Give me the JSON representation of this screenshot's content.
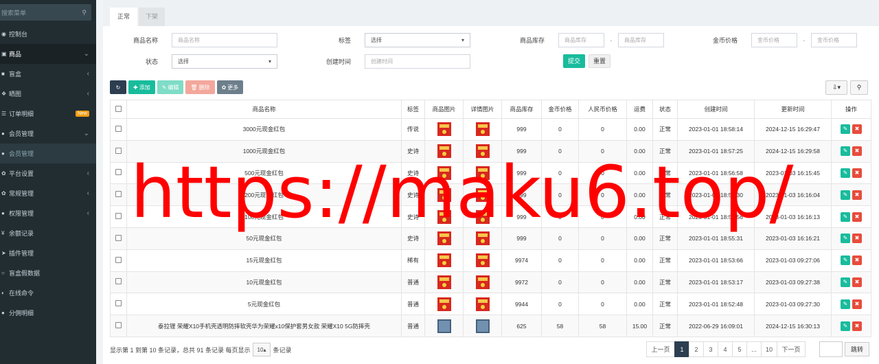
{
  "sidebar": {
    "search_placeholder": "搜索菜单",
    "items": [
      {
        "icon": "dashboard-icon",
        "glyph": "◉",
        "label": "控制台",
        "arrow": ""
      },
      {
        "icon": "shopping-bag-icon",
        "glyph": "▣",
        "label": "商品",
        "arrow": "⌄",
        "state": "active"
      },
      {
        "icon": "cube-icon",
        "glyph": "■",
        "label": "盲盒",
        "arrow": "‹"
      },
      {
        "icon": "gift-icon",
        "glyph": "❖",
        "label": "晒图",
        "arrow": "‹"
      },
      {
        "icon": "list-icon",
        "glyph": "☰",
        "label": "订单明细",
        "badge": "New"
      },
      {
        "icon": "users-icon",
        "glyph": "●",
        "label": "会员管理",
        "arrow": "⌄"
      },
      {
        "icon": "user-icon",
        "glyph": "●",
        "label": "会员管理",
        "arrow": "",
        "state": "sub"
      },
      {
        "icon": "gear-icon",
        "glyph": "✿",
        "label": "平台设置",
        "arrow": "‹"
      },
      {
        "icon": "gears-icon",
        "glyph": "✿",
        "label": "常规管理",
        "arrow": "‹"
      },
      {
        "icon": "users-icon",
        "glyph": "●",
        "label": "权限管理",
        "arrow": "‹"
      },
      {
        "icon": "yen-icon",
        "glyph": "¥",
        "label": "余额记录",
        "arrow": ""
      },
      {
        "icon": "rocket-icon",
        "glyph": "➤",
        "label": "插件管理",
        "arrow": ""
      },
      {
        "icon": "circle-icon",
        "glyph": "○",
        "label": "盲盒假数据",
        "arrow": ""
      },
      {
        "icon": "toggle-icon",
        "glyph": "◐",
        "label": "在线命令",
        "arrow": ""
      },
      {
        "icon": "users-icon",
        "glyph": "●",
        "label": "分佣明细",
        "arrow": ""
      }
    ]
  },
  "tabs": {
    "normal": "正常",
    "off": "下架"
  },
  "filters": {
    "name_label": "商品名称",
    "name_placeholder": "商品名称",
    "tag_label": "标签",
    "tag_value": "选择",
    "stock_label": "商品库存",
    "stock_min_placeholder": "商品库存",
    "stock_max_placeholder": "商品库存",
    "coin_label": "金币价格",
    "coin_min_placeholder": "金币价格",
    "coin_max_placeholder": "金币价格",
    "status_label": "状态",
    "status_value": "选择",
    "created_label": "创建时间",
    "created_placeholder": "创建时间",
    "dash": "-",
    "submit": "提交",
    "reset": "重置"
  },
  "toolbar": {
    "add": "添加",
    "edit": "编辑",
    "delete": "删除",
    "more": "更多"
  },
  "table": {
    "headers": [
      "商品名称",
      "标签",
      "商品图片",
      "详情图片",
      "商品库存",
      "金币价格",
      "人民币价格",
      "运费",
      "状态",
      "创建时间",
      "更新时间",
      "操作"
    ],
    "rows": [
      {
        "name": "3000元现金红包",
        "tag": "传说",
        "tag_type": "legend",
        "img": "red",
        "stock": "999",
        "coin": "0",
        "rmb": "0",
        "ship": "0.00",
        "status": "正常",
        "created": "2023-01-01 18:58:14",
        "updated": "2024-12-15 16:29:47"
      },
      {
        "name": "1000元现金红包",
        "tag": "史诗",
        "tag_type": "epic",
        "img": "red",
        "stock": "999",
        "coin": "0",
        "rmb": "0",
        "ship": "0.00",
        "status": "正常",
        "created": "2023-01-01 18:57:25",
        "updated": "2024-12-15 16:29:58"
      },
      {
        "name": "500元现金红包",
        "tag": "史诗",
        "tag_type": "epic",
        "img": "red",
        "stock": "999",
        "coin": "0",
        "rmb": "0",
        "ship": "0.00",
        "status": "正常",
        "created": "2023-01-01 18:56:58",
        "updated": "2023-01-03 16:15:45"
      },
      {
        "name": "200元现金红包",
        "tag": "史诗",
        "tag_type": "epic",
        "img": "red",
        "stock": "999",
        "coin": "0",
        "rmb": "0",
        "ship": "0.00",
        "status": "正常",
        "created": "2023-01-01 18:56:30",
        "updated": "2023-01-03 16:16:04"
      },
      {
        "name": "100元现金红包",
        "tag": "史诗",
        "tag_type": "epic",
        "img": "red",
        "stock": "999",
        "coin": "0",
        "rmb": "0",
        "ship": "0.00",
        "status": "正常",
        "created": "2023-01-01 18:55:56",
        "updated": "2023-01-03 16:16:13"
      },
      {
        "name": "50元现金红包",
        "tag": "史诗",
        "tag_type": "epic",
        "img": "red",
        "stock": "999",
        "coin": "0",
        "rmb": "0",
        "ship": "0.00",
        "status": "正常",
        "created": "2023-01-01 18:55:31",
        "updated": "2023-01-03 16:16:21"
      },
      {
        "name": "15元现金红包",
        "tag": "稀有",
        "tag_type": "rare",
        "img": "red",
        "stock": "9974",
        "coin": "0",
        "rmb": "0",
        "ship": "0.00",
        "status": "正常",
        "created": "2023-01-01 18:53:66",
        "updated": "2023-01-03 09:27:06"
      },
      {
        "name": "10元现金红包",
        "tag": "普通",
        "tag_type": "common",
        "img": "red",
        "stock": "9972",
        "coin": "0",
        "rmb": "0",
        "ship": "0.00",
        "status": "正常",
        "created": "2023-01-01 18:53:17",
        "updated": "2023-01-03 09:27:38"
      },
      {
        "name": "5元现金红包",
        "tag": "普通",
        "tag_type": "common",
        "img": "red",
        "stock": "9944",
        "coin": "0",
        "rmb": "0",
        "ship": "0.00",
        "status": "正常",
        "created": "2023-01-01 18:52:48",
        "updated": "2023-01-03 09:27:30"
      },
      {
        "name": "泰拉锂 荣耀X10手机壳透明防摔软壳华为荣耀x10保护套男女款 荣耀X10 5G防摔壳",
        "tag": "普通",
        "tag_type": "common",
        "img": "phone",
        "stock": "625",
        "coin": "58",
        "rmb": "58",
        "ship": "15.00",
        "status": "正常",
        "created": "2022-06-29 16:09:01",
        "updated": "2024-12-15 16:30:13"
      }
    ]
  },
  "footer": {
    "info": "显示第 1 到第 10 条记录，总共 91 条记录 每页显示",
    "page_size": "10",
    "suffix": "条记录",
    "prev": "上一页",
    "pages": [
      "1",
      "2",
      "3",
      "4",
      "5",
      "...",
      "10"
    ],
    "current": "1",
    "next": "下一页",
    "jump": "跳转"
  },
  "watermark": "https://maku6.top/",
  "colors": {
    "sidebar": "#222d32",
    "accent": "#18bc9c",
    "danger": "#e74c3c",
    "watermark": "#ff0000"
  }
}
